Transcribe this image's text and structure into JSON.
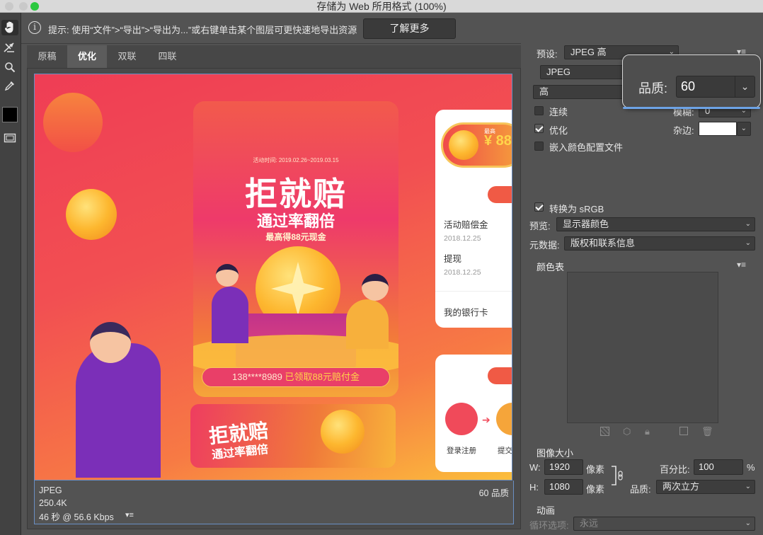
{
  "window": {
    "title": "存储为 Web 所用格式 (100%)"
  },
  "hint": {
    "text": "提示: 使用“文件”>“导出”>“导出为...”或右键单击某个图层可更快速地导出资源",
    "learn_more": "了解更多"
  },
  "tabs": [
    {
      "label": "原稿"
    },
    {
      "label": "优化"
    },
    {
      "label": "双联"
    },
    {
      "label": "四联"
    }
  ],
  "status": {
    "format": "JPEG",
    "size": "250.4K",
    "time": "46 秒 @ 56.6 Kbps",
    "quality": "60 品质"
  },
  "artwork": {
    "activity_date": "活动时间: 2019.02.26~2019.03.15",
    "headline": "拒就赔",
    "subheadline": "通过率翻倍",
    "ribbon": "最高得88元现金",
    "claim_prefix": "138****8989 ",
    "claim_highlight": "已领取88元赔付金",
    "banner_title": "拒就赔",
    "banner_sub": "通过率翻倍",
    "side_top_label": "最高",
    "side_top_value": "¥ 88",
    "list": [
      {
        "title": "活动赔偿金",
        "date": "2018.12.25"
      },
      {
        "title": "提现",
        "date": "2018.12.25"
      },
      {
        "title": "我的银行卡",
        "date": ""
      }
    ],
    "step_register": "登录注册",
    "step_submit": "提交"
  },
  "settings": {
    "preset_label": "预设:",
    "preset_value": "JPEG 高",
    "format_value": "JPEG",
    "quality_level": "高",
    "progressive_label": "连续",
    "progressive_checked": false,
    "optimized_label": "优化",
    "optimized_checked": true,
    "embed_profile_label": "嵌入颜色配置文件",
    "embed_profile_checked": false,
    "blur_label": "模糊:",
    "blur_value": "0",
    "matte_label": "杂边:",
    "matte_color": "#ffffff",
    "quality_popover_label": "品质:",
    "quality_value": "60",
    "convert_srgb_label": "转换为 sRGB",
    "convert_srgb_checked": true,
    "preview_label": "预览:",
    "preview_value": "显示器颜色",
    "metadata_label": "元数据:",
    "metadata_value": "版权和联系信息",
    "color_table_label": "颜色表"
  },
  "image_size": {
    "section_title": "图像大小",
    "w_label": "W:",
    "w_value": "1920",
    "h_label": "H:",
    "h_value": "1080",
    "unit": "像素",
    "percent_label": "百分比:",
    "percent_value": "100",
    "percent_unit": "%",
    "quality_label": "品质:",
    "quality_value": "两次立方"
  },
  "animation": {
    "section_title": "动画",
    "loop_label": "循环选项:",
    "loop_value": "永远"
  }
}
